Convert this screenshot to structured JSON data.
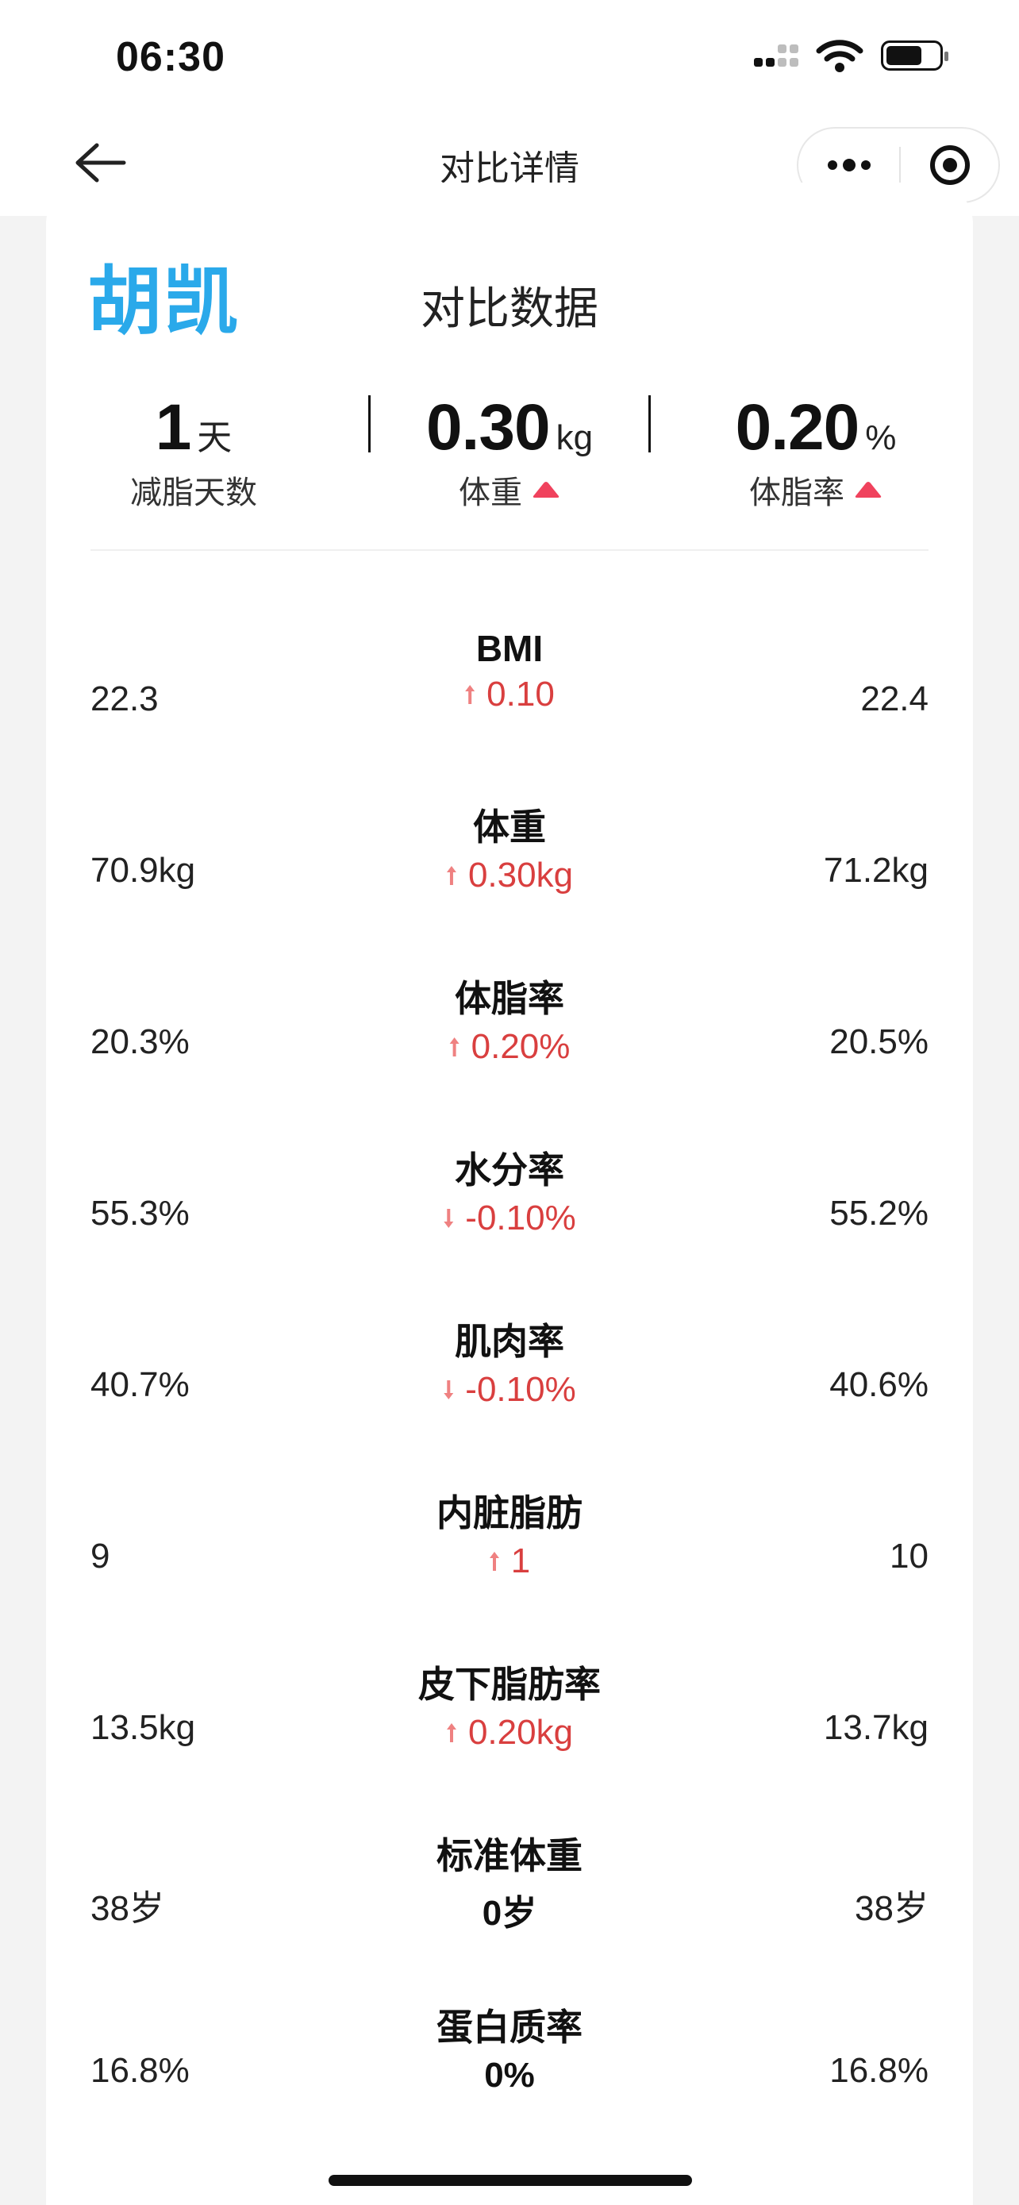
{
  "status_bar": {
    "time": "06:30"
  },
  "nav": {
    "title": "对比详情"
  },
  "card": {
    "user_name": "胡凯",
    "title": "对比数据",
    "summary": [
      {
        "value": "1",
        "unit": "天",
        "label": "减脂天数",
        "trend": ""
      },
      {
        "value": "0.30",
        "unit": "kg",
        "label": "体重",
        "trend": "up"
      },
      {
        "value": "0.20",
        "unit": "%",
        "label": "体脂率",
        "trend": "up"
      }
    ],
    "metrics": [
      {
        "name": "BMI",
        "left": "22.3",
        "right": "22.4",
        "delta": "0.10",
        "dir": "up"
      },
      {
        "name": "体重",
        "left": "70.9kg",
        "right": "71.2kg",
        "delta": "0.30kg",
        "dir": "up"
      },
      {
        "name": "体脂率",
        "left": "20.3%",
        "right": "20.5%",
        "delta": "0.20%",
        "dir": "up"
      },
      {
        "name": "水分率",
        "left": "55.3%",
        "right": "55.2%",
        "delta": "-0.10%",
        "dir": "down"
      },
      {
        "name": "肌肉率",
        "left": "40.7%",
        "right": "40.6%",
        "delta": "-0.10%",
        "dir": "down"
      },
      {
        "name": "内脏脂肪",
        "left": "9",
        "right": "10",
        "delta": "1",
        "dir": "up"
      },
      {
        "name": "皮下脂肪率",
        "left": "13.5kg",
        "right": "13.7kg",
        "delta": "0.20kg",
        "dir": "up"
      },
      {
        "name": "标准体重",
        "left": "38岁",
        "right": "38岁",
        "delta": "0岁",
        "dir": "none"
      },
      {
        "name": "蛋白质率",
        "left": "16.8%",
        "right": "16.8%",
        "delta": "0%",
        "dir": "none"
      }
    ]
  },
  "colors": {
    "accent_blue": "#2aa9ea",
    "trend_red": "#d93f3f",
    "triangle_red": "#f0425d"
  }
}
